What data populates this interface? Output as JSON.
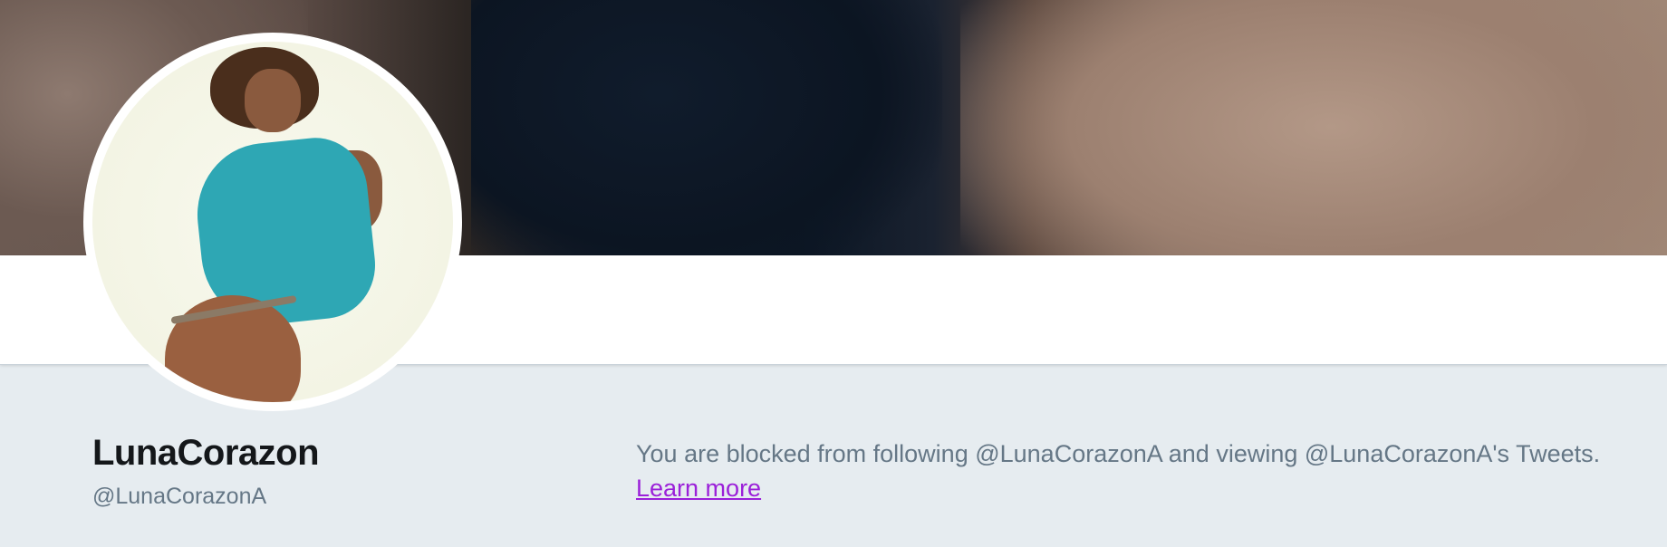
{
  "profile": {
    "name": "LunaCorazon",
    "handle": "@LunaCorazonA"
  },
  "blocked_notice": {
    "message": "You are blocked from following @LunaCorazonA and viewing @LunaCorazonA's Tweets.",
    "learn_more_label": "Learn more"
  },
  "colors": {
    "page_background": "#e6ecf0",
    "name_text": "#14171a",
    "secondary_text": "#657786",
    "link_visited": "#9b20d9"
  }
}
